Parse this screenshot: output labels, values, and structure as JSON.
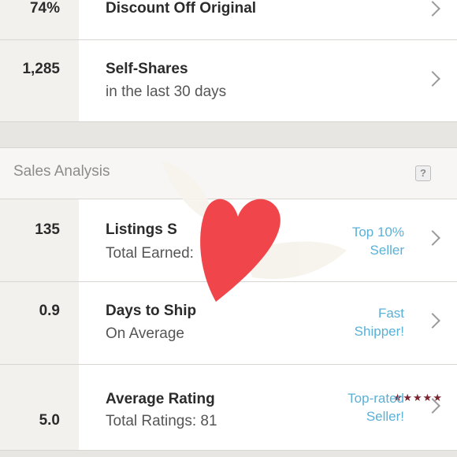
{
  "rows_top": [
    {
      "value": "74%",
      "title": "Discount Off Original",
      "sub": ""
    },
    {
      "value": "1,285",
      "title": "Self-Shares",
      "sub": "in the last 30 days"
    }
  ],
  "sales": {
    "header": "Sales Analysis",
    "help_label": "?",
    "rows": [
      {
        "value": "135",
        "title": "Listings S",
        "sub": "Total Earned:",
        "badge_line1": "Top 10%",
        "badge_line2": "Seller"
      },
      {
        "value": "0.9",
        "title": "Days to Ship",
        "sub": "On Average",
        "badge_line1": "Fast",
        "badge_line2": "Shipper!"
      },
      {
        "value": "5.0",
        "title": "Average Rating",
        "sub": "Total Ratings: 81",
        "badge_line1": "Top-rated",
        "badge_line2": "Seller!",
        "stars": "★★★★★",
        "rating": 5
      }
    ]
  },
  "colors": {
    "badge": "#5ab0d6",
    "heart": "#f0464b",
    "stars": "#7a2430"
  },
  "icons": {
    "chevron": "chevron-right-icon",
    "help": "help-icon",
    "sticker": "winged-heart-icon"
  }
}
